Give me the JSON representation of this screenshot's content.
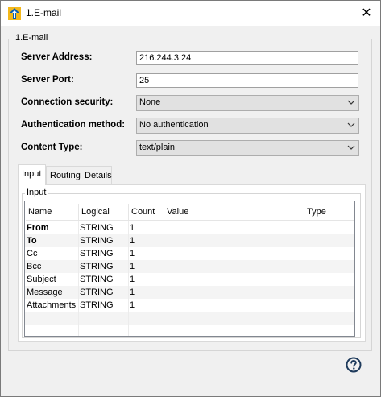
{
  "window": {
    "title": "1.E-mail",
    "close_glyph": "✕"
  },
  "group": {
    "label": "1.E-mail"
  },
  "form": {
    "server_address": {
      "label": "Server Address:",
      "value": "216.244.3.24"
    },
    "server_port": {
      "label": "Server Port:",
      "value": "25"
    },
    "connection_security": {
      "label": "Connection security:",
      "value": "None"
    },
    "auth_method": {
      "label": "Authentication method:",
      "value": "No authentication"
    },
    "content_type": {
      "label": "Content Type:",
      "value": "text/plain"
    }
  },
  "tabs": [
    {
      "label": "Input",
      "active": true
    },
    {
      "label": "Routing",
      "active": false
    },
    {
      "label": "Details",
      "active": false
    }
  ],
  "input_panel": {
    "label": "Input",
    "columns": [
      "Name",
      "Logical",
      "Count",
      "Value",
      "Type"
    ],
    "rows": [
      {
        "name": "From",
        "logical": "STRING",
        "count": "1",
        "value": "",
        "type": "",
        "bold": true
      },
      {
        "name": "To",
        "logical": "STRING",
        "count": "1",
        "value": "",
        "type": "",
        "bold": true
      },
      {
        "name": "Cc",
        "logical": "STRING",
        "count": "1",
        "value": "",
        "type": "",
        "bold": false
      },
      {
        "name": "Bcc",
        "logical": "STRING",
        "count": "1",
        "value": "",
        "type": "",
        "bold": false
      },
      {
        "name": "Subject",
        "logical": "STRING",
        "count": "1",
        "value": "",
        "type": "",
        "bold": false
      },
      {
        "name": "Message",
        "logical": "STRING",
        "count": "1",
        "value": "",
        "type": "",
        "bold": false
      },
      {
        "name": "Attachments",
        "logical": "STRING",
        "count": "1",
        "value": "",
        "type": "",
        "bold": false
      }
    ]
  },
  "colors": {
    "accent": "#0a5fb4",
    "icon_yellow": "#f3b81b",
    "help": "#1f3b5c"
  }
}
